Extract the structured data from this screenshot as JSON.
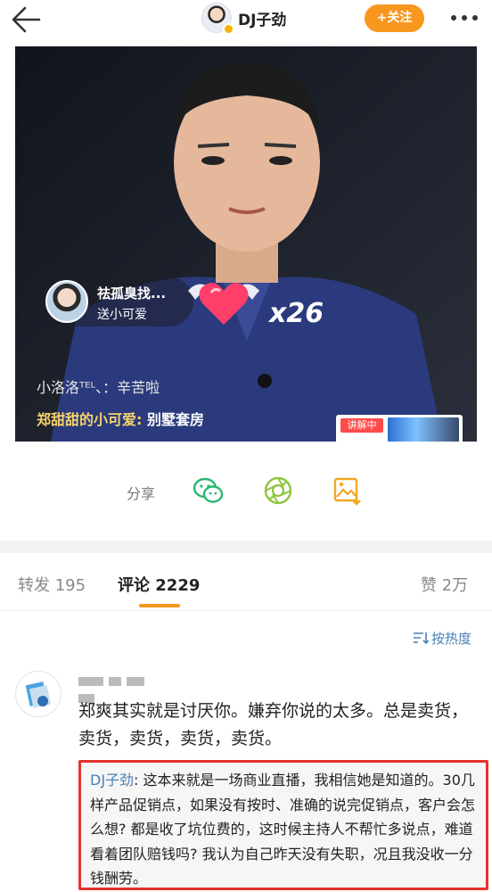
{
  "header": {
    "title": "DJ子劲",
    "follow_label": "+关注"
  },
  "video": {
    "gift_user": "祛孤臭找...",
    "gift_action": "送小可爱",
    "gift_count": "x26",
    "live_comment_1": "小洛洛ᵀᴱᴸ、：辛苦啦",
    "live_comment_2_user": "郑甜甜的小可爱:",
    "live_comment_2_text": "别墅套房",
    "product_tag": "讲解中"
  },
  "share": {
    "label": "分享"
  },
  "tabs": [
    {
      "label": "转发 195"
    },
    {
      "label": "评论 2229"
    },
    {
      "label": "赞 2万"
    }
  ],
  "sort_label": "按热度",
  "comment": {
    "text": "郑爽其实就是讨厌你。嫌弃你说的太多。总是卖货，卖货，卖货，卖货，卖货。",
    "reply_user": "DJ子劲",
    "reply_text": ": 这本来就是一场商业直播，我相信她是知道的。30几样产品促销点，如果没有按时、准确的说完促销点，客户会怎么想? 都是收了坑位费的，这时候主持人不帮忙多说点，难道看着团队赔钱吗? 我认为自己昨天没有失职，况且我没收一分钱酬劳。"
  },
  "colors": {
    "accent": "#f7971e",
    "link": "#4a7fb5",
    "highlight_border": "#e5322d"
  },
  "icons": [
    "back-arrow-icon",
    "more-icon",
    "wechat-icon",
    "moments-icon",
    "save-image-icon",
    "sort-icon",
    "heart-wings-icon"
  ]
}
